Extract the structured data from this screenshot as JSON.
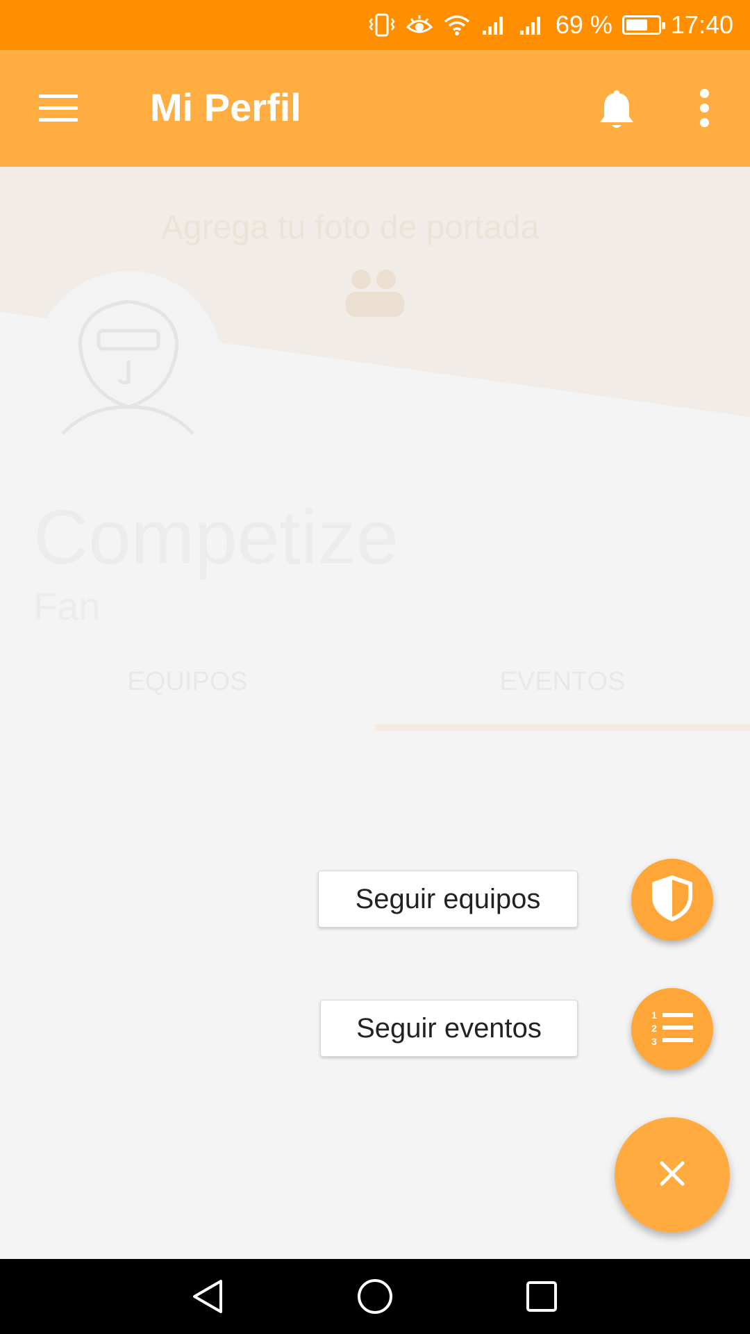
{
  "status_bar": {
    "battery_text": "69 %",
    "battery_level": 0.69,
    "time": "17:40",
    "icons": [
      "vibrate-icon",
      "eye-icon",
      "wifi-icon",
      "signal-icon",
      "signal-icon"
    ]
  },
  "app_bar": {
    "title": "Mi Perfil",
    "menu_icon": "hamburger-menu-icon",
    "notifications_icon": "bell-icon",
    "more_icon": "more-vert-icon"
  },
  "profile": {
    "cover_prompt": "Agrega tu foto de portada",
    "name": "Competize",
    "role": "Fan"
  },
  "tabs": [
    {
      "label": "EQUIPOS",
      "selected": false
    },
    {
      "label": "EVENTOS",
      "selected": true
    }
  ],
  "speed_dial": {
    "actions": [
      {
        "label": "Seguir equipos",
        "icon": "shield-icon"
      },
      {
        "label": "Seguir eventos",
        "icon": "numbered-list-icon"
      }
    ],
    "close_icon": "close-icon"
  },
  "colors": {
    "status_bar": "#ff8f00",
    "app_bar": "#ffac40",
    "fab": "#ffab40",
    "background": "#f4f4f4"
  },
  "nav_bar": {
    "buttons": [
      "back-icon",
      "home-icon",
      "recents-icon"
    ]
  }
}
